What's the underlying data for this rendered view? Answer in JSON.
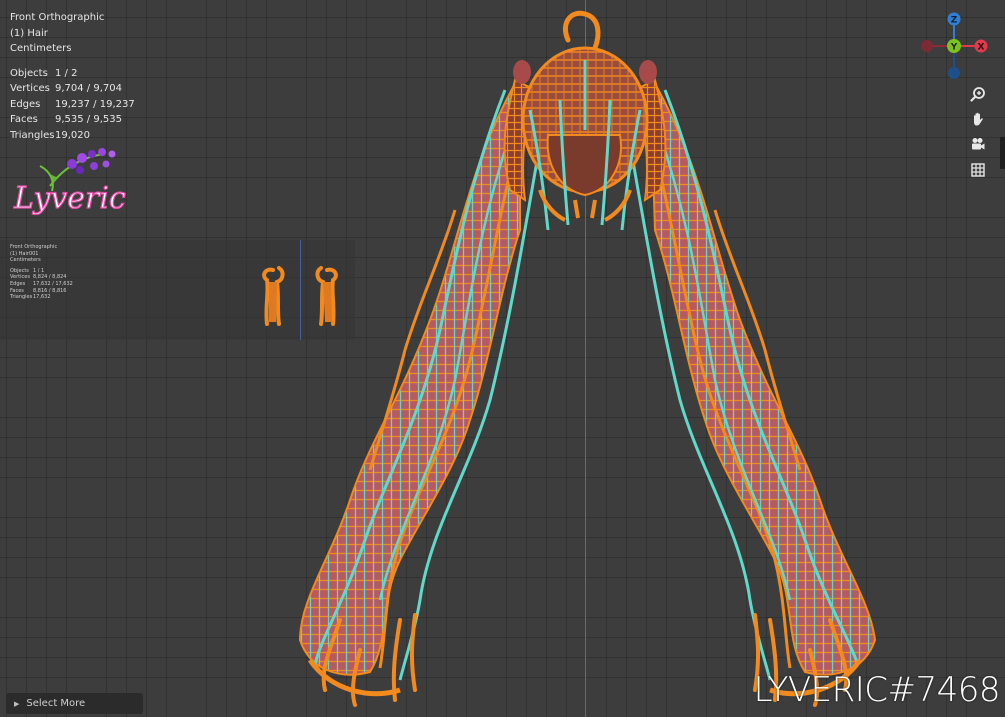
{
  "viewport": {
    "view_name": "Front Orthographic",
    "object_name": "(1) Hair",
    "units": "Centimeters",
    "stats": [
      {
        "label": "Objects",
        "value": "1 / 2"
      },
      {
        "label": "Vertices",
        "value": "9,704 / 9,704"
      },
      {
        "label": "Edges",
        "value": "19,237 / 19,237"
      },
      {
        "label": "Faces",
        "value": "9,535 / 9,535"
      },
      {
        "label": "Triangles",
        "value": "19,020"
      }
    ]
  },
  "inset": {
    "view_name": "Front Orthographic",
    "object_name": "(1) Hair001",
    "units": "Centimeters",
    "stats": [
      {
        "label": "Objects",
        "value": "1 / 1"
      },
      {
        "label": "Vertices",
        "value": "8,824 / 8,824"
      },
      {
        "label": "Edges",
        "value": "17,632 / 17,632"
      },
      {
        "label": "Faces",
        "value": "8,816 / 8,816"
      },
      {
        "label": "Triangles",
        "value": "17,632"
      }
    ]
  },
  "gizmo": {
    "z_label": "Z",
    "y_label": "Y",
    "x_label": "X"
  },
  "nav_tools": [
    "zoom-icon",
    "hand-pan-icon",
    "camera-icon",
    "grid-icon"
  ],
  "status": {
    "select_more_label": "Select More"
  },
  "logo_text": "Lyveric",
  "watermark": "LYVERIC#7468",
  "colors": {
    "background": "#3d3d3d",
    "wire_orange": "#f28a1e",
    "wire_cyan": "#5fd9c9",
    "mesh_fill": "#b5535a",
    "axis_blue": "#4f74c6",
    "gizmo_x": "#e0394a",
    "gizmo_y": "#7bc31c",
    "gizmo_z": "#2e7fd6"
  }
}
